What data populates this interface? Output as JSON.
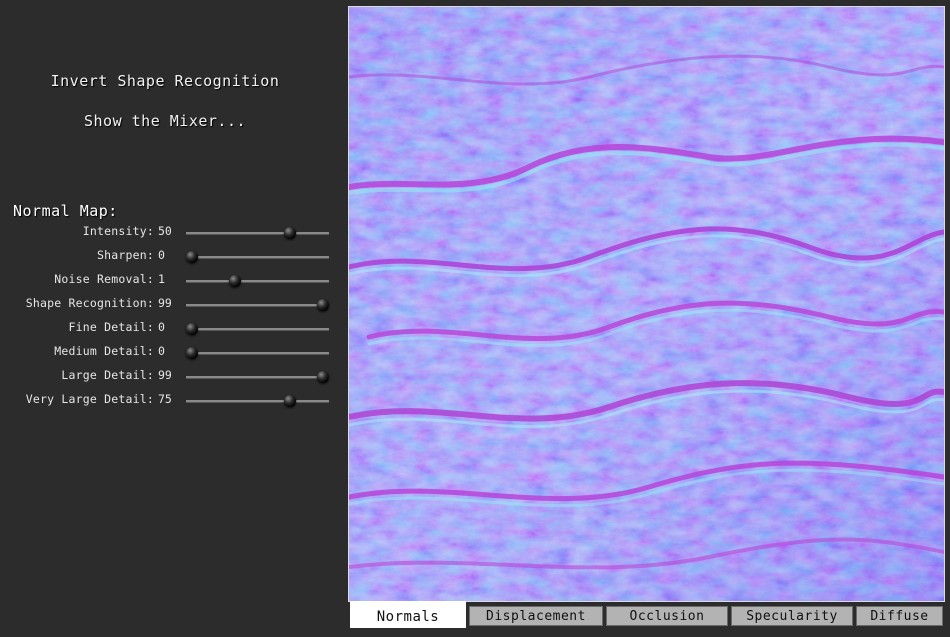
{
  "actions": {
    "invert_shape": "Invert Shape Recognition",
    "show_mixer": "Show the Mixer..."
  },
  "normal_map": {
    "title": "Normal Map:",
    "sliders": [
      {
        "label": "Intensity:",
        "value": "50",
        "fraction": 0.73
      },
      {
        "label": "Sharpen:",
        "value": "0",
        "fraction": 0.04
      },
      {
        "label": "Noise Removal:",
        "value": "1",
        "fraction": 0.34
      },
      {
        "label": "Shape Recognition:",
        "value": "99",
        "fraction": 0.96
      },
      {
        "label": "Fine Detail:",
        "value": "0",
        "fraction": 0.04
      },
      {
        "label": "Medium Detail:",
        "value": "0",
        "fraction": 0.04
      },
      {
        "label": "Large Detail:",
        "value": "99",
        "fraction": 0.96
      },
      {
        "label": "Very Large Detail:",
        "value": "75",
        "fraction": 0.73
      }
    ]
  },
  "tabs": [
    {
      "label": "Normals",
      "active": true
    },
    {
      "label": "Displacement",
      "active": false
    },
    {
      "label": "Occlusion",
      "active": false
    },
    {
      "label": "Specularity",
      "active": false
    },
    {
      "label": "Diffuse",
      "active": false
    }
  ],
  "colors": {
    "panel_bg": "#2c2c2c",
    "normal_base": "#7a78f0",
    "normal_magenta": "#b03ad8",
    "normal_cyan": "#7fe0f0"
  }
}
